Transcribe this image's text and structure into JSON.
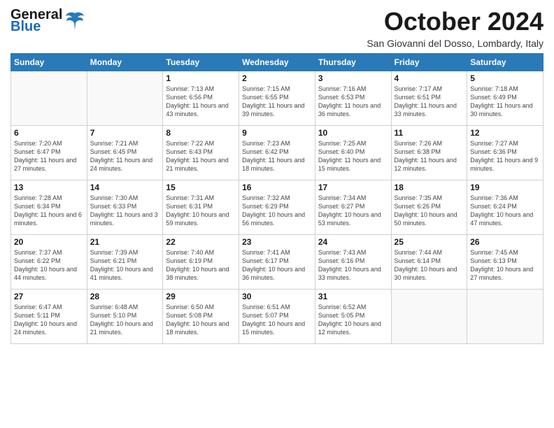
{
  "header": {
    "logo_general": "General",
    "logo_blue": "Blue",
    "month_title": "October 2024",
    "subtitle": "San Giovanni del Dosso, Lombardy, Italy"
  },
  "days_of_week": [
    "Sunday",
    "Monday",
    "Tuesday",
    "Wednesday",
    "Thursday",
    "Friday",
    "Saturday"
  ],
  "weeks": [
    [
      {
        "day": "",
        "info": ""
      },
      {
        "day": "",
        "info": ""
      },
      {
        "day": "1",
        "info": "Sunrise: 7:13 AM\nSunset: 6:56 PM\nDaylight: 11 hours and 43 minutes."
      },
      {
        "day": "2",
        "info": "Sunrise: 7:15 AM\nSunset: 6:55 PM\nDaylight: 11 hours and 39 minutes."
      },
      {
        "day": "3",
        "info": "Sunrise: 7:16 AM\nSunset: 6:53 PM\nDaylight: 11 hours and 36 minutes."
      },
      {
        "day": "4",
        "info": "Sunrise: 7:17 AM\nSunset: 6:51 PM\nDaylight: 11 hours and 33 minutes."
      },
      {
        "day": "5",
        "info": "Sunrise: 7:18 AM\nSunset: 6:49 PM\nDaylight: 11 hours and 30 minutes."
      }
    ],
    [
      {
        "day": "6",
        "info": "Sunrise: 7:20 AM\nSunset: 6:47 PM\nDaylight: 11 hours and 27 minutes."
      },
      {
        "day": "7",
        "info": "Sunrise: 7:21 AM\nSunset: 6:45 PM\nDaylight: 11 hours and 24 minutes."
      },
      {
        "day": "8",
        "info": "Sunrise: 7:22 AM\nSunset: 6:43 PM\nDaylight: 11 hours and 21 minutes."
      },
      {
        "day": "9",
        "info": "Sunrise: 7:23 AM\nSunset: 6:42 PM\nDaylight: 11 hours and 18 minutes."
      },
      {
        "day": "10",
        "info": "Sunrise: 7:25 AM\nSunset: 6:40 PM\nDaylight: 11 hours and 15 minutes."
      },
      {
        "day": "11",
        "info": "Sunrise: 7:26 AM\nSunset: 6:38 PM\nDaylight: 11 hours and 12 minutes."
      },
      {
        "day": "12",
        "info": "Sunrise: 7:27 AM\nSunset: 6:36 PM\nDaylight: 11 hours and 9 minutes."
      }
    ],
    [
      {
        "day": "13",
        "info": "Sunrise: 7:28 AM\nSunset: 6:34 PM\nDaylight: 11 hours and 6 minutes."
      },
      {
        "day": "14",
        "info": "Sunrise: 7:30 AM\nSunset: 6:33 PM\nDaylight: 11 hours and 3 minutes."
      },
      {
        "day": "15",
        "info": "Sunrise: 7:31 AM\nSunset: 6:31 PM\nDaylight: 10 hours and 59 minutes."
      },
      {
        "day": "16",
        "info": "Sunrise: 7:32 AM\nSunset: 6:29 PM\nDaylight: 10 hours and 56 minutes."
      },
      {
        "day": "17",
        "info": "Sunrise: 7:34 AM\nSunset: 6:27 PM\nDaylight: 10 hours and 53 minutes."
      },
      {
        "day": "18",
        "info": "Sunrise: 7:35 AM\nSunset: 6:26 PM\nDaylight: 10 hours and 50 minutes."
      },
      {
        "day": "19",
        "info": "Sunrise: 7:36 AM\nSunset: 6:24 PM\nDaylight: 10 hours and 47 minutes."
      }
    ],
    [
      {
        "day": "20",
        "info": "Sunrise: 7:37 AM\nSunset: 6:22 PM\nDaylight: 10 hours and 44 minutes."
      },
      {
        "day": "21",
        "info": "Sunrise: 7:39 AM\nSunset: 6:21 PM\nDaylight: 10 hours and 41 minutes."
      },
      {
        "day": "22",
        "info": "Sunrise: 7:40 AM\nSunset: 6:19 PM\nDaylight: 10 hours and 38 minutes."
      },
      {
        "day": "23",
        "info": "Sunrise: 7:41 AM\nSunset: 6:17 PM\nDaylight: 10 hours and 36 minutes."
      },
      {
        "day": "24",
        "info": "Sunrise: 7:43 AM\nSunset: 6:16 PM\nDaylight: 10 hours and 33 minutes."
      },
      {
        "day": "25",
        "info": "Sunrise: 7:44 AM\nSunset: 6:14 PM\nDaylight: 10 hours and 30 minutes."
      },
      {
        "day": "26",
        "info": "Sunrise: 7:45 AM\nSunset: 6:13 PM\nDaylight: 10 hours and 27 minutes."
      }
    ],
    [
      {
        "day": "27",
        "info": "Sunrise: 6:47 AM\nSunset: 5:11 PM\nDaylight: 10 hours and 24 minutes."
      },
      {
        "day": "28",
        "info": "Sunrise: 6:48 AM\nSunset: 5:10 PM\nDaylight: 10 hours and 21 minutes."
      },
      {
        "day": "29",
        "info": "Sunrise: 6:50 AM\nSunset: 5:08 PM\nDaylight: 10 hours and 18 minutes."
      },
      {
        "day": "30",
        "info": "Sunrise: 6:51 AM\nSunset: 5:07 PM\nDaylight: 10 hours and 15 minutes."
      },
      {
        "day": "31",
        "info": "Sunrise: 6:52 AM\nSunset: 5:05 PM\nDaylight: 10 hours and 12 minutes."
      },
      {
        "day": "",
        "info": ""
      },
      {
        "day": "",
        "info": ""
      }
    ]
  ]
}
